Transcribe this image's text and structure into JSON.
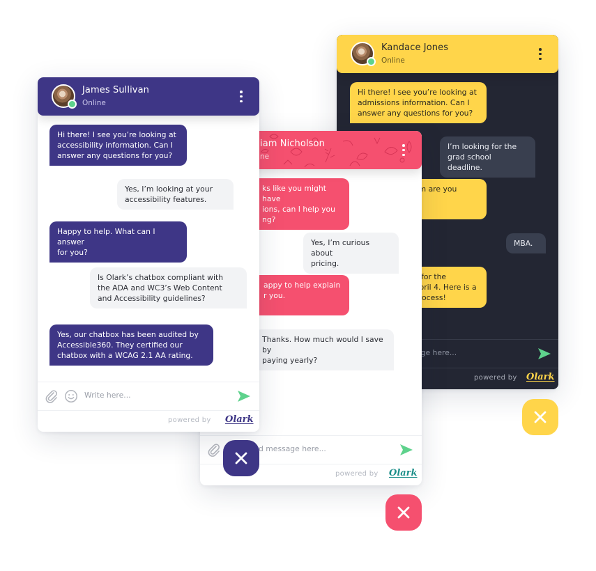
{
  "colors": {
    "purple": "#3e3686",
    "pink": "#f5506f",
    "yellow": "#ffd54a",
    "dark": "#232633",
    "online": "#5ed28c",
    "send": "#5ed28c"
  },
  "widgets": {
    "yellow": {
      "agent_name": "Kandace Jones",
      "agent_status": "Online",
      "avatar_icon": "agent-avatar",
      "messages": [
        {
          "from": "agent",
          "text": "Hi there! I see you’re looking at\nadmissions information. Can I\nanswer any questions for you?"
        },
        {
          "from": "visitor",
          "text": "I’m looking for the\ngrad school deadline."
        },
        {
          "from": "agent",
          "text": "am are you"
        },
        {
          "from": "visitor",
          "text": "MBA."
        },
        {
          "from": "agent",
          "text": "e for the\nApril 4. Here is a\nprocess!"
        }
      ],
      "input_placeholder": "age here...",
      "powered_by": "powered by",
      "brand": "Olark",
      "close_icon": "close-icon"
    },
    "pink": {
      "agent_name": "iam Nicholson",
      "agent_status": "ne",
      "messages": [
        {
          "from": "agent",
          "text": "ks like you might have\nions, can I help you\nng?"
        },
        {
          "from": "visitor",
          "text": "Yes, I’m curious about\npricing."
        },
        {
          "from": "agent",
          "text": "appy to help explain\nr you."
        },
        {
          "from": "visitor",
          "text": "Thanks. How much would I save by\npaying yearly?"
        }
      ],
      "input_placeholder": "d message here...",
      "powered_by": "powered by",
      "brand": "Olark",
      "close_icon": "close-icon"
    },
    "purple": {
      "agent_name": "James Sullivan",
      "agent_status": "Online",
      "messages": [
        {
          "from": "agent",
          "text": "Hi there! I see you’re looking at\naccessibility information. Can I\nanswer any questions for you?"
        },
        {
          "from": "visitor",
          "text": "Yes, I’m looking at your\naccessibility features."
        },
        {
          "from": "agent",
          "text": "Happy to help. What can I answer\nfor you?"
        },
        {
          "from": "visitor",
          "text": "Is Olark’s chatbox compliant with\nthe ADA and WC3’s Web Content\nand Accessibility guidelines?"
        },
        {
          "from": "agent",
          "text": "Yes, our chatbox has been audited by\nAccessible360. They certified our\nchatbox with a WCAG 2.1 AA rating."
        }
      ],
      "input_placeholder": "Write here...",
      "powered_by": "powered by",
      "brand": "Olark",
      "close_icon": "close-icon"
    }
  }
}
